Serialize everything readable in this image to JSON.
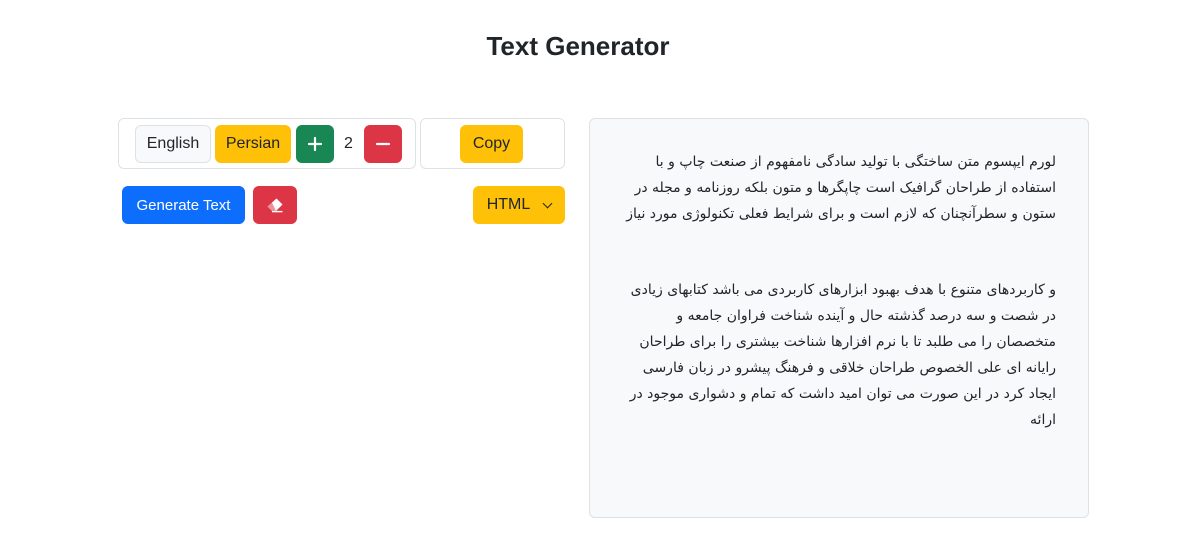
{
  "header": {
    "title": "Text Generator"
  },
  "language": {
    "english_label": "English",
    "persian_label": "Persian",
    "selected": "Persian"
  },
  "paragraphs": {
    "increment_icon": "plus-icon",
    "count": "2",
    "decrement_icon": "minus-icon"
  },
  "copy": {
    "label": "Copy"
  },
  "actions": {
    "generate_label": "Generate Text",
    "clear_icon": "eraser-icon"
  },
  "format_select": {
    "selected": "HTML"
  },
  "output": {
    "paragraphs": [
      "لورم ایپسوم متن ساختگی با تولید سادگی نامفهوم از صنعت چاپ و با استفاده از طراحان گرافیک است چاپگرها و متون بلکه روزنامه و مجله در ستون و سطرآنچنان که لازم است و برای شرایط فعلی تکنولوژی مورد نیاز",
      "و کاربردهای متنوع با هدف بهبود ابزارهای کاربردی می باشد کتابهای زیادی در شصت و سه درصد گذشته حال و آینده شناخت فراوان جامعه و متخصصان را می طلبد تا با نرم افزارها شناخت بیشتری را برای طراحان رایانه ای علی الخصوص طراحان خلاقی و فرهنگ پیشرو در زبان فارسی ایجاد کرد در این صورت می توان امید داشت که تمام و دشواری موجود در ارائه"
    ]
  },
  "colors": {
    "primary": "#0d6efd",
    "success": "#198754",
    "danger": "#dc3545",
    "warning": "#ffc107",
    "light": "#f8f9fa"
  }
}
